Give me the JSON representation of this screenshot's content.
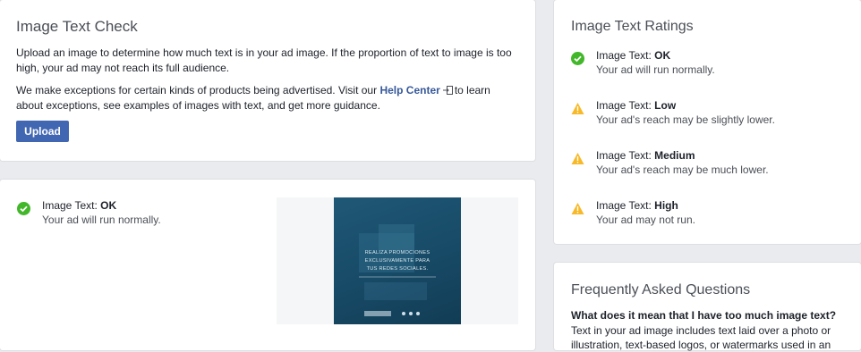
{
  "check": {
    "title": "Image Text Check",
    "para1": "Upload an image to determine how much text is in your ad image. If the proportion of text to image is too high, your ad may not reach its full audience.",
    "para2_before": "We make exceptions for certain kinds of products being advertised. Visit our",
    "help_link": "Help Center",
    "para2_after": "to learn about exceptions, see examples of images with text, and get more guidance.",
    "upload_label": "Upload"
  },
  "result": {
    "prefix": "Image Text:",
    "rating": "OK",
    "message": "Your ad will run normally.",
    "preview_text": [
      "REALIZA PROMOCIONES",
      "EXCLUSIVAMENTE PARA",
      "TUS REDES SOCIALES."
    ]
  },
  "ratings": {
    "title": "Image Text Ratings",
    "items": [
      {
        "prefix": "Image Text:",
        "level": "OK",
        "message": "Your ad will run normally.",
        "icon": "check-circle-icon",
        "color": "#42b72a"
      },
      {
        "prefix": "Image Text:",
        "level": "Low",
        "message": "Your ad's reach may be slightly lower.",
        "icon": "warning-icon",
        "color": "#f7b928"
      },
      {
        "prefix": "Image Text:",
        "level": "Medium",
        "message": "Your ad's reach may be much lower.",
        "icon": "warning-icon",
        "color": "#f7b928"
      },
      {
        "prefix": "Image Text:",
        "level": "High",
        "message": "Your ad may not run.",
        "icon": "warning-icon",
        "color": "#f7b928"
      }
    ]
  },
  "faq": {
    "title": "Frequently Asked Questions",
    "question": "What does it mean that I have too much image text?",
    "answer": "Text in your ad image includes text laid over a photo or illustration, text-based logos, or watermarks used in an"
  },
  "colors": {
    "accent": "#4267b2",
    "link": "#365899",
    "ok": "#42b72a",
    "warning": "#f7b928"
  }
}
